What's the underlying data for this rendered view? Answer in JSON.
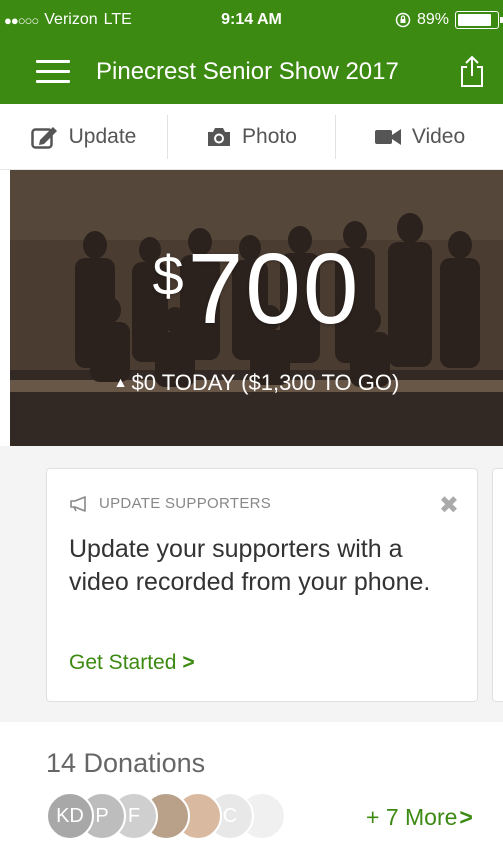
{
  "status_bar": {
    "signal_dots": "●●○○○",
    "carrier": "Verizon",
    "network": "LTE",
    "time": "9:14 AM",
    "battery": "89%",
    "battery_level": 0.89
  },
  "nav": {
    "title": "Pinecrest Senior Show 2017"
  },
  "actions": [
    {
      "label": "Update",
      "icon": "pencil-square-icon"
    },
    {
      "label": "Photo",
      "icon": "camera-icon"
    },
    {
      "label": "Video",
      "icon": "video-camera-icon"
    }
  ],
  "hero": {
    "currency": "$",
    "amount": "700",
    "today_text": "$0 TODAY ($1,300 TO GO)"
  },
  "card": {
    "header": "UPDATE SUPPORTERS",
    "body": "Update your supporters with a video recorded from your phone.",
    "link": "Get Started",
    "link_chevron": ">"
  },
  "donations": {
    "title": "14 Donations",
    "avatars": [
      {
        "initials": "KD",
        "color": "#a8a8a8"
      },
      {
        "initials": "P",
        "color": "#bdbdbd"
      },
      {
        "initials": "F",
        "color": "#cfcfcf"
      },
      {
        "initials": "",
        "color": "#b8a089"
      },
      {
        "initials": "",
        "color": "#d9b9a0"
      },
      {
        "initials": "C",
        "color": "#e8e8e8"
      },
      {
        "initials": "",
        "color": "#f0f0f0"
      }
    ],
    "more": "+ 7 More",
    "more_chevron": ">"
  },
  "colors": {
    "brand_green": "#3c8a12"
  }
}
